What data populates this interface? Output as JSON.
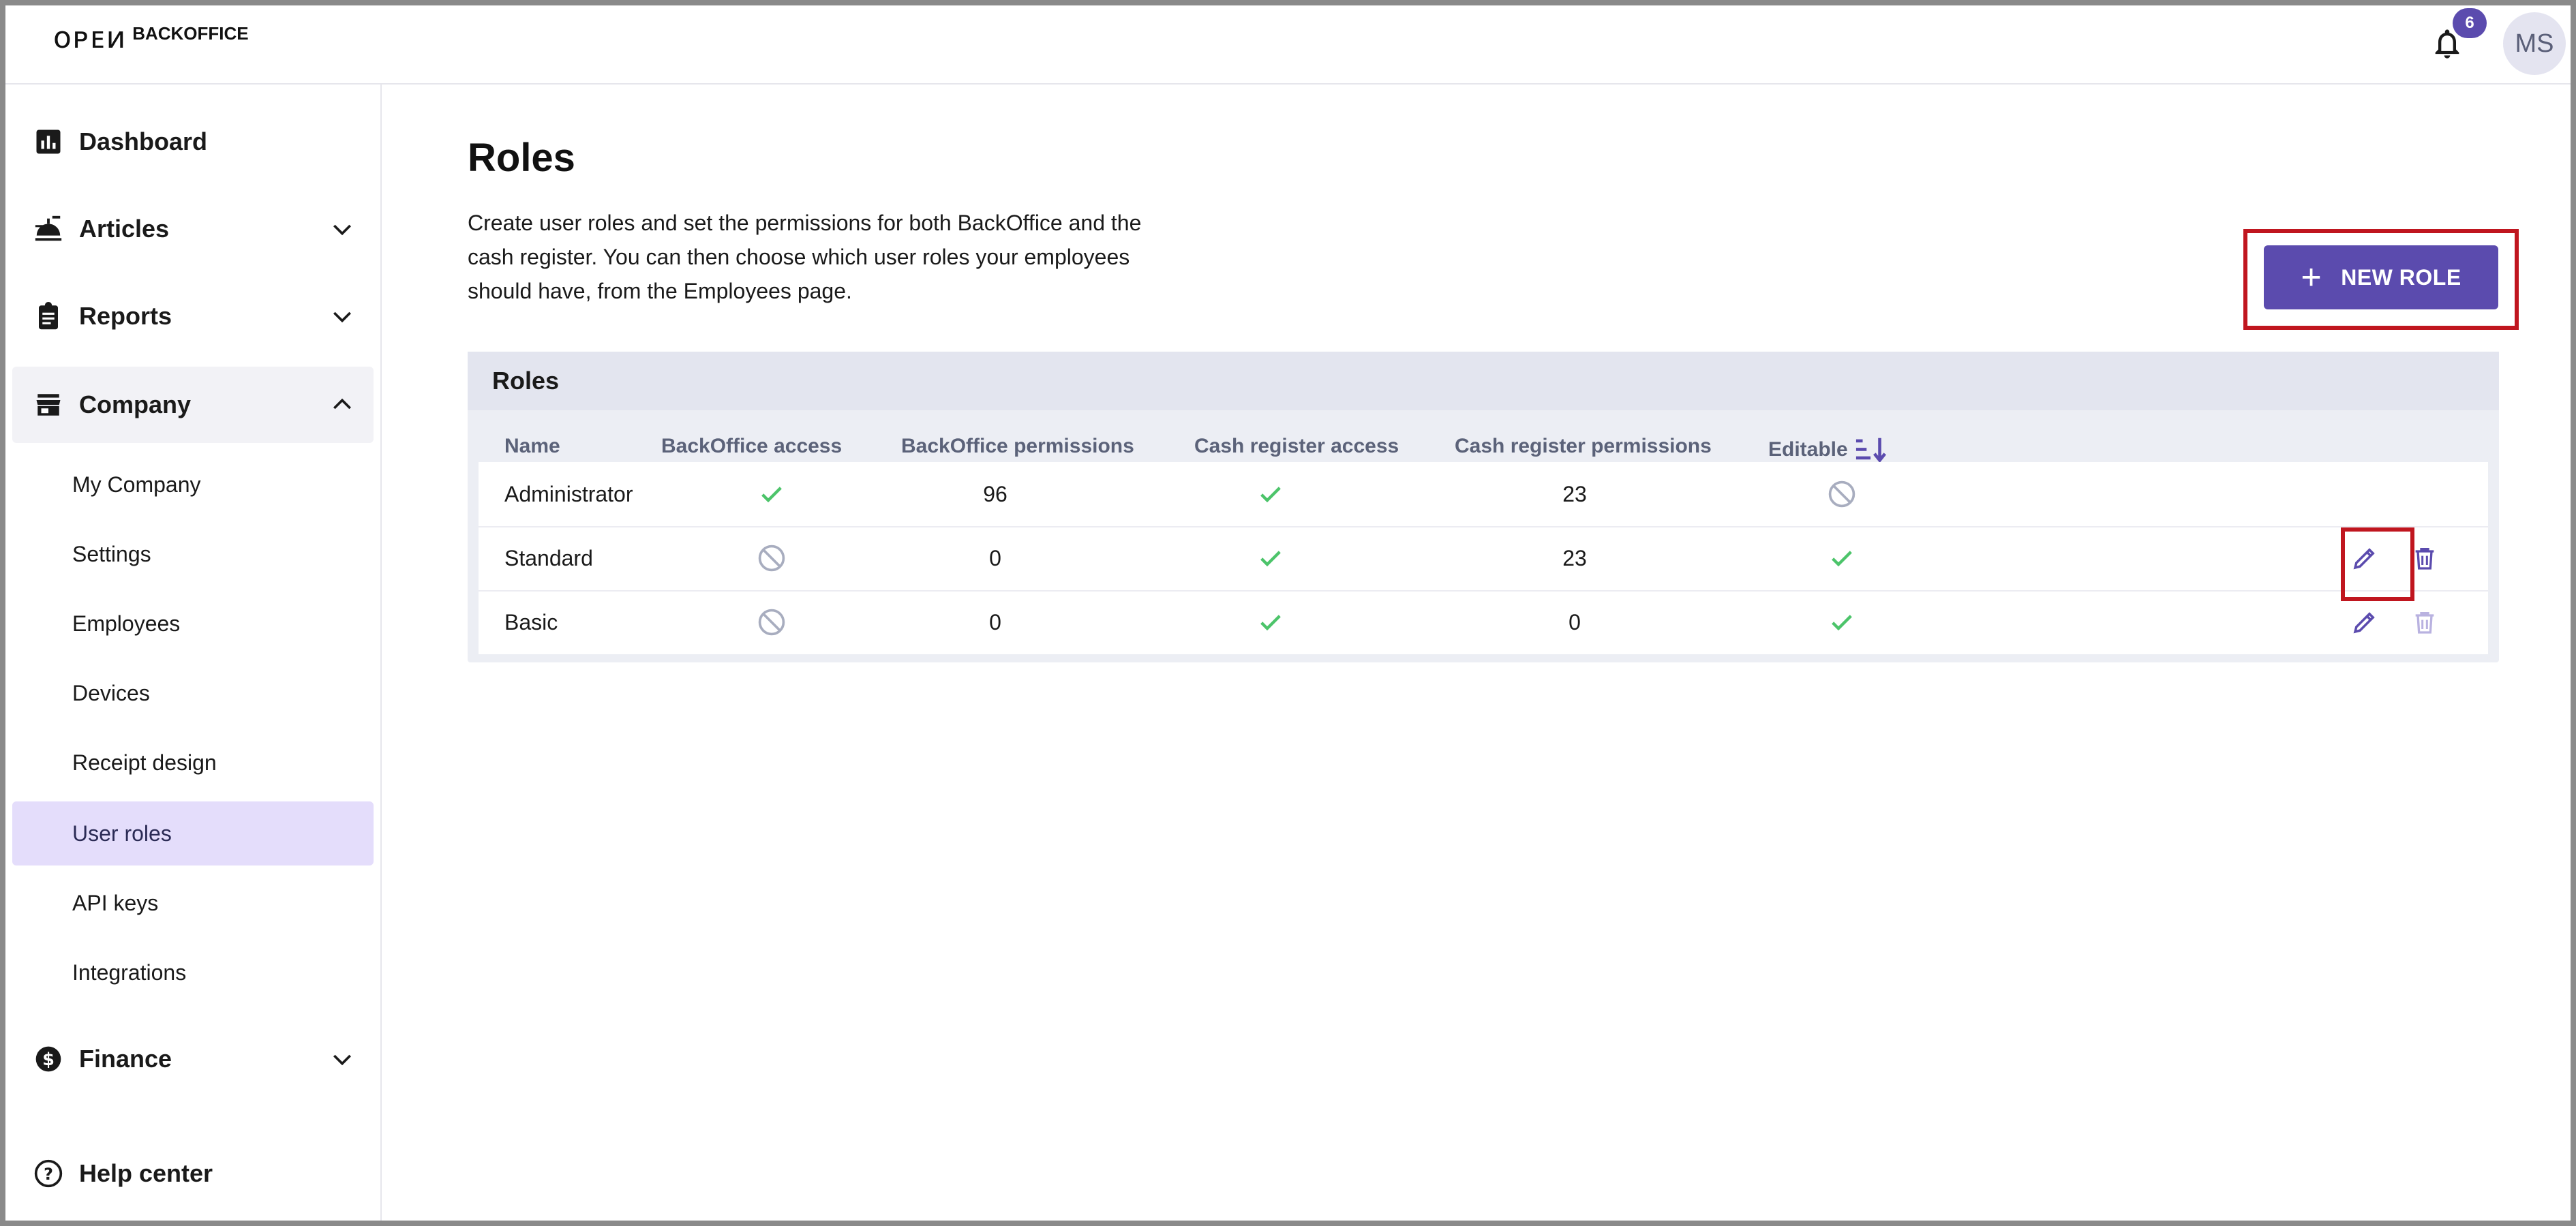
{
  "header": {
    "logo_mark": "ᴏᴩᴇᴎ",
    "logo_text": "BACKOFFICE",
    "notification_count": "6",
    "user_initials": "MS"
  },
  "sidebar": {
    "dashboard": "Dashboard",
    "articles": "Articles",
    "reports": "Reports",
    "company": "Company",
    "company_items": [
      "My Company",
      "Settings",
      "Employees",
      "Devices",
      "Receipt design",
      "User roles",
      "API keys",
      "Integrations"
    ],
    "finance": "Finance",
    "help": "Help center"
  },
  "main": {
    "title": "Roles",
    "description": "Create user roles and set the permissions for both BackOffice and the cash register. You can then choose which user roles your employees should have, from the Employees page.",
    "new_role_label": "NEW ROLE",
    "table": {
      "title": "Roles",
      "columns": [
        "Name",
        "BackOffice access",
        "BackOffice permissions",
        "Cash register access",
        "Cash register permissions",
        "Editable"
      ],
      "rows": [
        {
          "name": "Administrator",
          "bo_access": "check",
          "bo_permissions": "96",
          "cr_access": "check",
          "cr_permissions": "23",
          "editable": "blocked",
          "can_edit": false,
          "can_delete": false
        },
        {
          "name": "Standard",
          "bo_access": "blocked",
          "bo_permissions": "0",
          "cr_access": "check",
          "cr_permissions": "23",
          "editable": "check",
          "can_edit": true,
          "can_delete": true
        },
        {
          "name": "Basic",
          "bo_access": "blocked",
          "bo_permissions": "0",
          "cr_access": "check",
          "cr_permissions": "0",
          "editable": "check",
          "can_edit": true,
          "can_delete": false
        }
      ]
    }
  },
  "colors": {
    "accent": "#5b4bae",
    "check": "#4cc46a",
    "blocked": "#a8adbf",
    "highlight": "#c0161f",
    "active_nav": "#e4ddfb"
  },
  "icons": {
    "check": "check-icon",
    "blocked": "blocked-icon",
    "edit": "pencil-icon",
    "delete": "trash-icon",
    "sort": "sort-icon"
  }
}
